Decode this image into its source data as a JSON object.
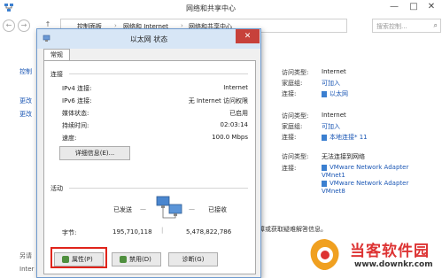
{
  "window": {
    "title": "网络和共享中心",
    "minimize": "—",
    "maximize": "□",
    "close": "✕"
  },
  "address": {
    "back": "←",
    "forward": "→",
    "up": "↑",
    "crumbs": [
      "控制面板",
      "网络和 Internet",
      "网络和共享中心"
    ],
    "search_placeholder": "搜索控制..."
  },
  "sidebar": {
    "items": [
      "控制",
      "更改",
      "更改"
    ]
  },
  "networks": [
    {
      "access_type_label": "访问类型:",
      "access_type": "Internet",
      "homegroup_label": "家庭组:",
      "homegroup": "可加入",
      "connection_label": "连接:",
      "connection": "以太网"
    },
    {
      "access_type_label": "访问类型:",
      "access_type": "Internet",
      "homegroup_label": "家庭组:",
      "homegroup": "可加入",
      "connection_label": "连接:",
      "connection": "本地连接* 11"
    },
    {
      "access_type_label": "访问类型:",
      "access_type": "无法连接到网络",
      "connection_label": "连接:",
      "connection_lines": [
        "VMware Network Adapter",
        "VMnet1",
        "VMware Network Adapter",
        "VMnet8"
      ]
    }
  ],
  "trouble_text": "障或获取疑难解答信息。",
  "see_also": [
    "另请",
    "Inter"
  ],
  "dialog": {
    "title": "以太网 状态",
    "close": "✕",
    "tab": "常规",
    "connection_section": "连接",
    "rows": [
      {
        "label": "IPv4 连接:",
        "value": "Internet"
      },
      {
        "label": "IPv6 连接:",
        "value": "无 Internet 访问权限"
      },
      {
        "label": "媒体状态:",
        "value": "已启用"
      },
      {
        "label": "持续时间:",
        "value": "02:03:14"
      },
      {
        "label": "速度:",
        "value": "100.0 Mbps"
      }
    ],
    "details_button": "详细信息(E)...",
    "activity_section": "活动",
    "sent_label": "已发送",
    "received_label": "已接收",
    "bytes_label": "字节:",
    "bytes_sent": "195,710,118",
    "bytes_received": "5,478,822,786",
    "properties_button": "属性(P)",
    "disable_button": "禁用(D)",
    "diagnose_button": "诊断(G)"
  },
  "watermark": {
    "text": "当客软件园",
    "url": "www.downkr.com"
  },
  "colors": {
    "link": "#1a56b4",
    "highlight_frame": "#e0241b",
    "dialog_border": "#6f9bcf",
    "close_button": "#c7413b"
  }
}
